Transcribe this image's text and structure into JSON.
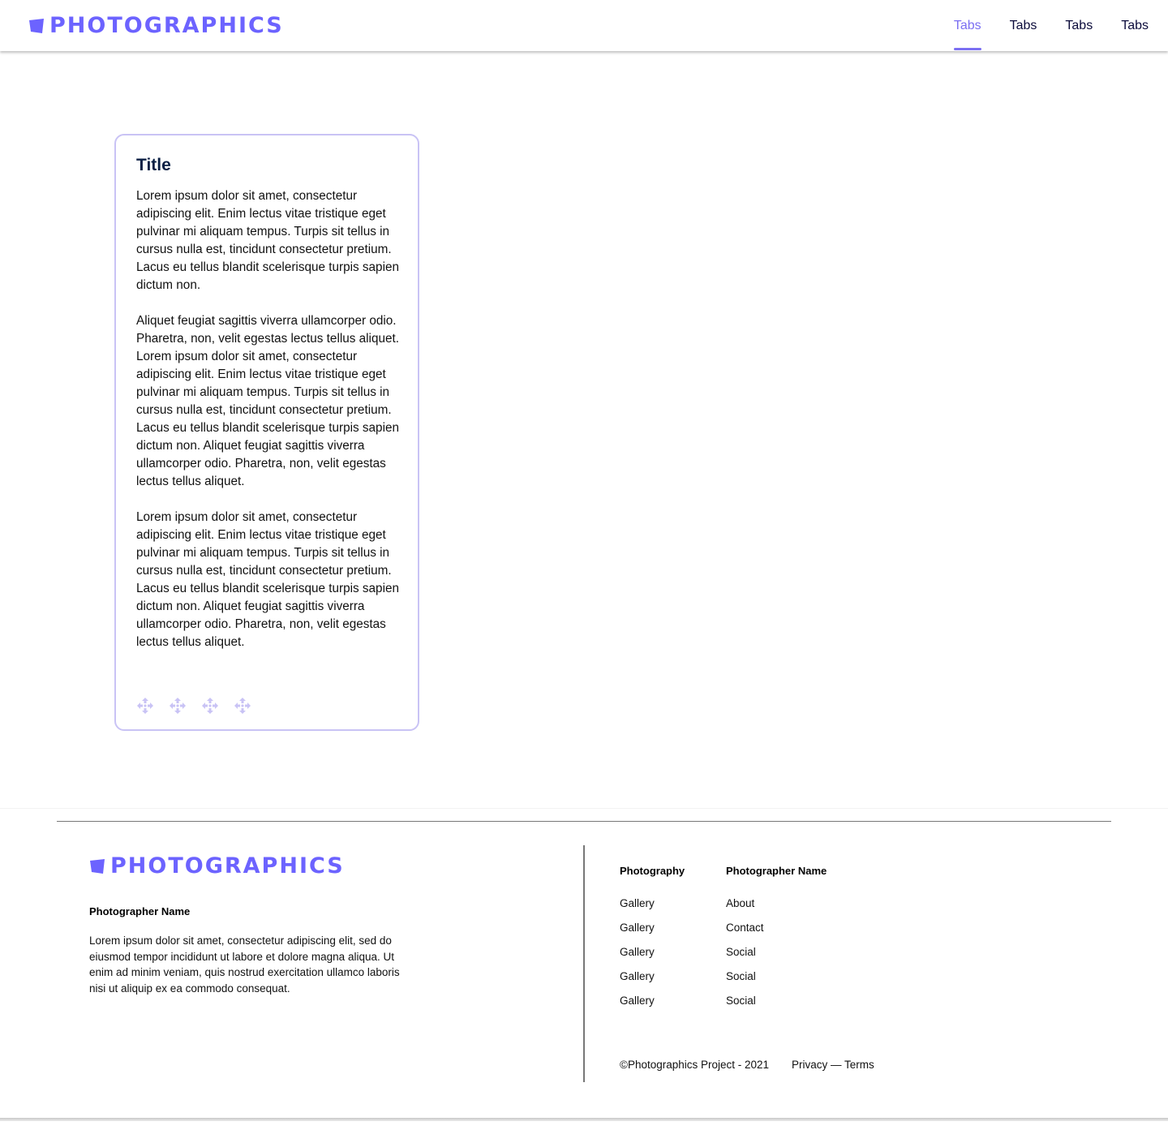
{
  "header": {
    "logo_text": "PHOTOGRAPHICS",
    "tabs": [
      {
        "label": "Tabs",
        "active": true
      },
      {
        "label": "Tabs",
        "active": false
      },
      {
        "label": "Tabs",
        "active": false
      },
      {
        "label": "Tabs",
        "active": false
      }
    ]
  },
  "card": {
    "title": "Title",
    "paragraphs": [
      "Lorem ipsum dolor sit amet, consectetur adipiscing elit. Enim lectus vitae tristique eget pulvinar mi aliquam tempus. Turpis sit tellus in cursus nulla est, tincidunt consectetur pretium. Lacus eu tellus blandit scelerisque turpis sapien dictum non.",
      "Aliquet feugiat sagittis viverra ullamcorper odio. Pharetra, non, velit egestas lectus tellus aliquet. Lorem ipsum dolor sit amet, consectetur adipiscing elit. Enim lectus vitae tristique eget pulvinar mi aliquam tempus. Turpis sit tellus in cursus nulla est, tincidunt consectetur pretium. Lacus eu tellus blandit scelerisque turpis sapien dictum non. Aliquet feugiat sagittis viverra ullamcorper odio. Pharetra, non, velit egestas lectus tellus aliquet.",
      "Lorem ipsum dolor sit amet, consectetur adipiscing elit. Enim lectus vitae tristique eget pulvinar mi aliquam tempus. Turpis sit tellus in cursus nulla est, tincidunt consectetur pretium. Lacus eu tellus blandit scelerisque turpis sapien dictum non. Aliquet feugiat sagittis viverra ullamcorper odio. Pharetra, non, velit egestas lectus tellus aliquet."
    ],
    "action_icons": [
      "move-icon",
      "move-icon",
      "move-icon",
      "move-icon"
    ]
  },
  "footer": {
    "logo_text": "PHOTOGRAPHICS",
    "photographer_name": "Photographer Name",
    "description": "Lorem ipsum dolor sit amet, consectetur adipiscing elit, sed do eiusmod tempor incididunt ut labore et dolore magna aliqua. Ut enim ad minim veniam, quis nostrud exercitation ullamco laboris nisi ut aliquip ex ea commodo consequat.",
    "col1": {
      "heading": "Photography",
      "links": [
        "Gallery",
        "Gallery",
        "Gallery",
        "Gallery",
        "Gallery"
      ]
    },
    "col2": {
      "heading": "Photographer Name",
      "links": [
        "About",
        "Contact",
        "Social",
        "Social",
        "Social"
      ]
    },
    "copyright": "©Photographics Project - 2021",
    "privacy": "Privacy",
    "separator": " — ",
    "terms": "Terms"
  },
  "colors": {
    "accent": "#6c63ff",
    "tab_active": "#7b6ff2",
    "card_border": "#c9c3f5",
    "icon_light": "#c9c3f5"
  }
}
